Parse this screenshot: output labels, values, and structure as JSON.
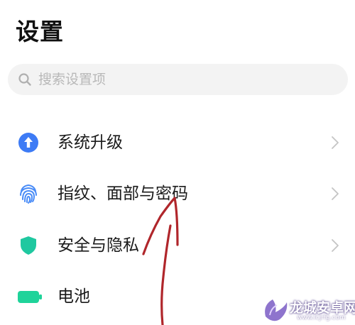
{
  "header": {
    "title": "设置"
  },
  "search": {
    "placeholder": "搜索设置项"
  },
  "items": [
    {
      "label": "系统升级",
      "icon": "upgrade-arrow-icon",
      "color": "#3d7bf5"
    },
    {
      "label": "指纹、面部与密码",
      "icon": "fingerprint-icon",
      "color": "#4a8cf7"
    },
    {
      "label": "安全与隐私",
      "icon": "shield-icon",
      "color": "#1fc8a0"
    },
    {
      "label": "电池",
      "icon": "battery-icon",
      "color": "#1fd39a"
    }
  ],
  "colors": {
    "annotation": "#b0262b",
    "chevron": "#c4c4c4"
  },
  "watermark": {
    "text": "龙城安卓网",
    "url": "www.lcjrfg.com"
  }
}
